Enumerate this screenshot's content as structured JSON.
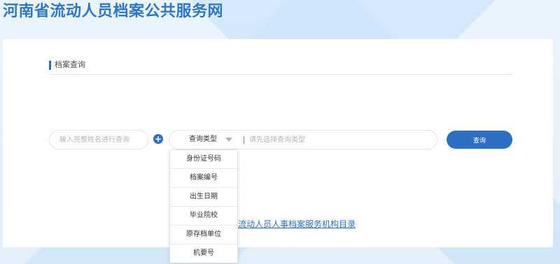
{
  "header": {
    "site_title": "河南省流动人员档案公共服务网"
  },
  "section": {
    "title": "档案查询"
  },
  "search": {
    "name_placeholder": "输入完整姓名进行查询",
    "plus_icon": "plus-icon",
    "type_select_label": "查询类型",
    "type_chevron_icon": "chevron-down-icon",
    "query_placeholder": "请先选择查询类型",
    "submit_label": "查询"
  },
  "dropdown": {
    "options": [
      "身份证号码",
      "档案编号",
      "出生日期",
      "毕业院校",
      "原存档单位",
      "机要号"
    ]
  },
  "links": {
    "directory": "流动人员人事档案服务机构目录"
  },
  "colors": {
    "primary": "#2c6fc5",
    "title": "#2a76c9",
    "background": "#e6f1fb"
  }
}
